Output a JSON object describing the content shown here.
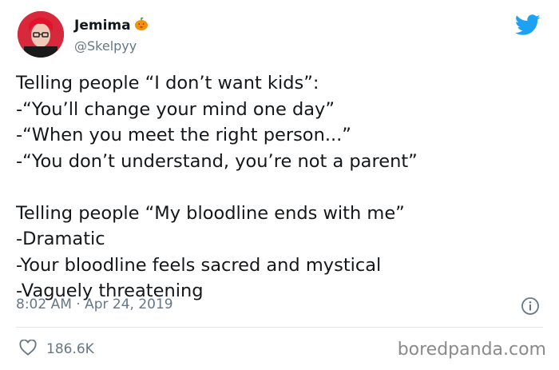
{
  "author": {
    "name": "Jemima",
    "handle": "@Skelpyy",
    "name_emoji": "pumpkin-icon"
  },
  "tweet": {
    "lines": [
      "Telling people “I don’t want kids”:",
      "-“You’ll change your mind one day”",
      "-“When you meet the right person...”",
      "-“You don’t understand, you’re not a parent”",
      "",
      "Telling people “My bloodline ends with me”",
      "-Dramatic",
      "-Your bloodline feels sacred and mystical",
      "-Vaguely threatening"
    ],
    "timestamp": "8:02 AM · Apr 24, 2019"
  },
  "engagement": {
    "likes": "186.6K"
  },
  "watermark": "boredpanda.com",
  "colors": {
    "twitter_blue": "#1da1f2",
    "meta_gray": "#657786",
    "text": "#14171a"
  }
}
